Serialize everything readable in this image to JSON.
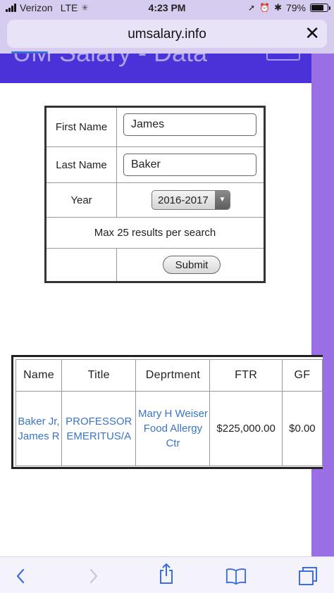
{
  "status_bar": {
    "carrier": "Verizon",
    "network": "LTE",
    "time": "4:23 PM",
    "battery": "79%",
    "battery_level": 0.79
  },
  "browser": {
    "url": "umsalary.info",
    "close_icon": "close-icon"
  },
  "header": {
    "title": "UM Salary - Data"
  },
  "search": {
    "first_name_label": "First Name",
    "first_name_value": "James",
    "last_name_label": "Last Name",
    "last_name_value": "Baker",
    "year_label": "Year",
    "year_value": "2016-2017",
    "note": "Max 25 results per search",
    "submit_label": "Submit"
  },
  "results": {
    "headers": [
      "Name",
      "Title",
      "Deprtment",
      "FTR",
      "GF"
    ],
    "rows": [
      {
        "name": "Baker Jr, James R",
        "title": "PROFESSOR EMERITUS/A",
        "department": "Mary H Weiser Food Allergy Ctr",
        "ftr": "$225,000.00",
        "gf": "$0.00"
      }
    ]
  },
  "toolbar": {
    "icons": [
      "back-icon",
      "forward-icon",
      "share-icon",
      "bookmarks-icon",
      "tabs-icon"
    ]
  },
  "colors": {
    "browser_chrome": "#d6ccef",
    "site_header": "#4a32d8",
    "right_strip": "#9a6ee4",
    "link": "#3a76c4"
  }
}
